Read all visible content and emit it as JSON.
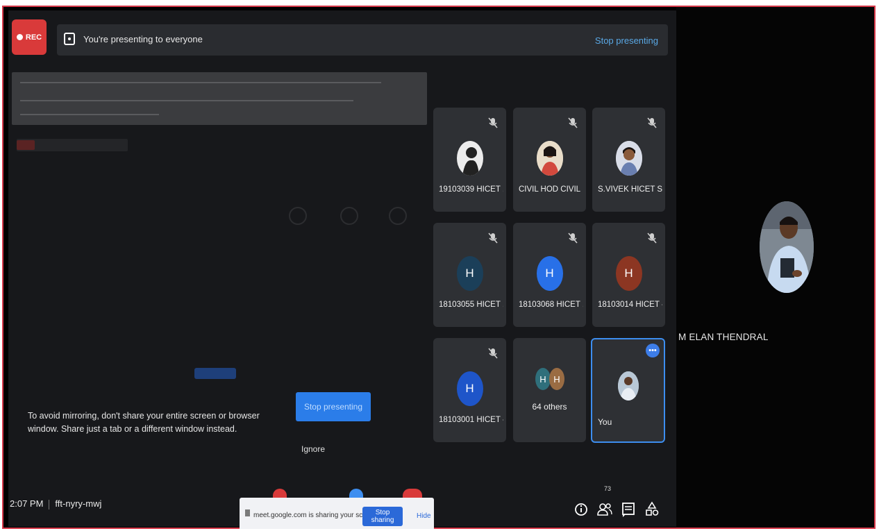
{
  "recording": {
    "label": "REC"
  },
  "presenting_bar": {
    "message": "You're presenting to everyone",
    "stop_label": "Stop presenting"
  },
  "warning": {
    "text": "To avoid mirroring, don't share your entire screen or browser window. Share just a tab or a different window instead.",
    "stop_button": "Stop presenting",
    "ignore_label": "Ignore"
  },
  "participants": [
    {
      "name": "19103039 HICET ...",
      "initial": "",
      "type": "photo",
      "color": "#e8e8e8"
    },
    {
      "name": "CIVIL HOD CIVIL",
      "initial": "",
      "type": "photo",
      "color": "#d47a55"
    },
    {
      "name": "S.VIVEK HICET ST...",
      "initial": "",
      "type": "photo",
      "color": "#c7c9d6"
    },
    {
      "name": "18103055 HICET ...",
      "initial": "H",
      "type": "initial",
      "color": "#1b3f59"
    },
    {
      "name": "18103068 HICET ...",
      "initial": "H",
      "type": "initial",
      "color": "#2870e8"
    },
    {
      "name": "18103014 HICET -...",
      "initial": "H",
      "type": "initial",
      "color": "#8c3622"
    },
    {
      "name": "18103001 HICET -...",
      "initial": "H",
      "type": "initial",
      "color": "#1e55c9"
    }
  ],
  "others_tile": {
    "label": "64 others",
    "initials": [
      "H",
      "H"
    ],
    "colors": [
      "#2f6f7b",
      "#9a6c43"
    ]
  },
  "self_tile": {
    "label": "You"
  },
  "main_speaker": {
    "name": "M ELAN THENDRAL"
  },
  "meeting": {
    "time": "2:07 PM",
    "code": "fft-nyry-mwj"
  },
  "share_banner": {
    "message": "meet.google.com is sharing your screen.",
    "stop_label": "Stop sharing",
    "hide_label": "Hide"
  },
  "toolbar": {
    "participant_count": "73"
  }
}
